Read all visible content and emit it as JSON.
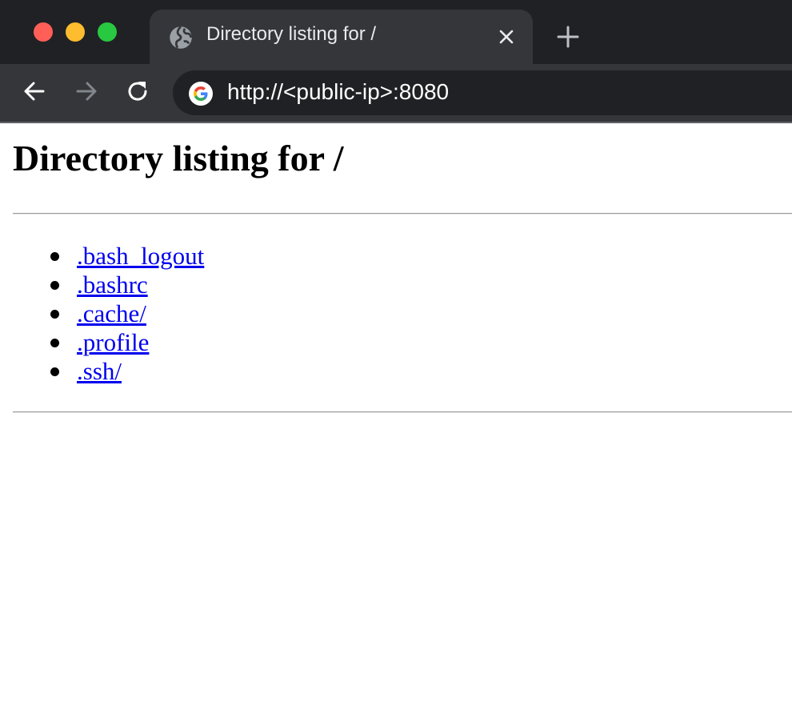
{
  "browser": {
    "tab": {
      "title": "Directory listing for /"
    },
    "address_bar": {
      "url": "http://<public-ip>:8080"
    },
    "icons": {
      "close": "close-icon",
      "new_tab": "plus-icon",
      "back": "arrow-left-icon",
      "forward": "arrow-right-icon",
      "reload": "reload-icon",
      "site": "globe-icon",
      "search_engine": "google-icon"
    },
    "colors": {
      "titlebar": "#202124",
      "toolbar": "#35363a",
      "link": "#0000ee",
      "traffic_red": "#ff5f57",
      "traffic_yellow": "#febc2e",
      "traffic_green": "#28c840"
    }
  },
  "page": {
    "heading": "Directory listing for /",
    "entries": [
      {
        "name": ".bash_logout"
      },
      {
        "name": ".bashrc"
      },
      {
        "name": ".cache/"
      },
      {
        "name": ".profile"
      },
      {
        "name": ".ssh/"
      }
    ]
  }
}
